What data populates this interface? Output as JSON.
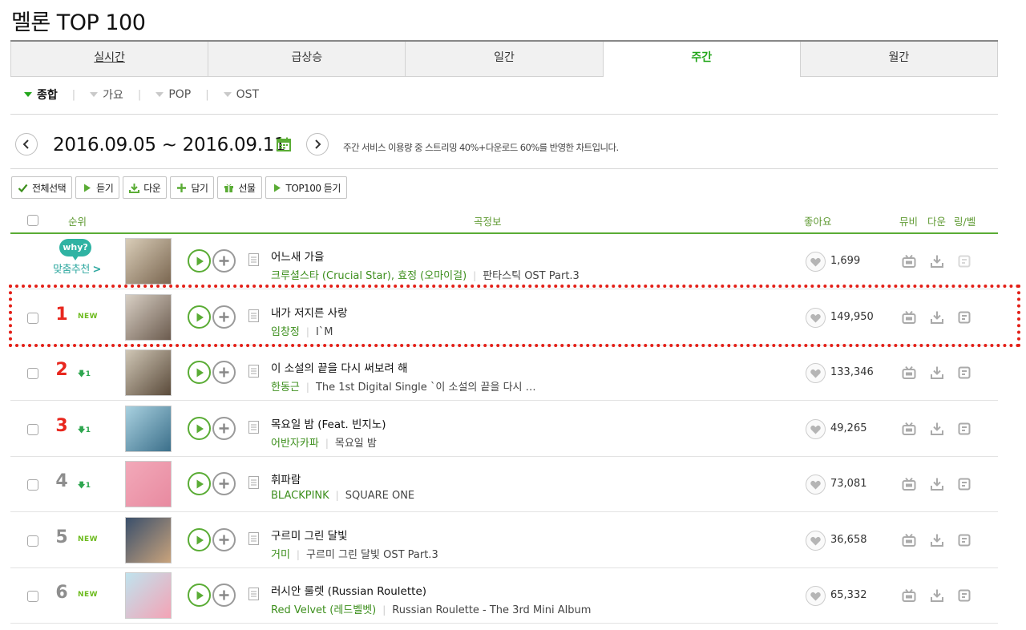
{
  "page": {
    "title": "멜론 TOP 100"
  },
  "tabs": [
    {
      "label": "실시간",
      "active": false
    },
    {
      "label": "급상승",
      "active": false
    },
    {
      "label": "일간",
      "active": false
    },
    {
      "label": "주간",
      "active": true
    },
    {
      "label": "월간",
      "active": false
    }
  ],
  "genres": [
    {
      "label": "종합",
      "active": true
    },
    {
      "label": "가요",
      "active": false
    },
    {
      "label": "POP",
      "active": false
    },
    {
      "label": "OST",
      "active": false
    }
  ],
  "date": {
    "range": "2016.09.05 ~ 2016.09.11",
    "description": "주간 서비스 이용량 중 스트리밍 40%+다운로드 60%를 반영한 차트입니다."
  },
  "actions": {
    "select_all": "전체선택",
    "listen": "듣기",
    "download": "다운",
    "add": "담기",
    "gift": "선물",
    "top100_listen": "TOP100 듣기"
  },
  "table_header": {
    "rank": "순위",
    "song_info": "곡정보",
    "likes": "좋아요",
    "mv": "뮤비",
    "download": "다운",
    "ring": "링/벨"
  },
  "recommend": {
    "badge": "why?",
    "text": "맞춤추천",
    "arrow": ">",
    "title": "어느새 가을",
    "artist": "크루셜스타 (Crucial Star), 효정 (오마이걸)",
    "album": "판타스틱 OST Part.3",
    "likes": "1,699"
  },
  "rows": [
    {
      "rank": "1",
      "change": "NEW",
      "change_type": "new",
      "title": "내가 저지른 사랑",
      "artist": "임창정",
      "album": "I`M",
      "likes": "149,950",
      "cover_colors": [
        "#d8cfc4",
        "#6b5b4e"
      ]
    },
    {
      "rank": "2",
      "change": "1",
      "change_type": "down",
      "title": "이 소설의 끝을 다시 써보려 해",
      "artist": "한동근",
      "album": "The 1st Digital Single `이 소설의 끝을 다시 …",
      "likes": "133,346",
      "cover_colors": [
        "#cfc6b5",
        "#5a4a3a"
      ]
    },
    {
      "rank": "3",
      "change": "1",
      "change_type": "down",
      "title": "목요일 밤 (Feat. 빈지노)",
      "artist": "어반자카파",
      "album": "목요일 밤",
      "likes": "49,265",
      "cover_colors": [
        "#a9d1e0",
        "#3b6f8a"
      ]
    },
    {
      "rank": "4",
      "change": "1",
      "change_type": "down",
      "title": "휘파람",
      "artist": "BLACKPINK",
      "album": "SQUARE ONE",
      "likes": "73,081",
      "cover_colors": [
        "#f2a9b9",
        "#e88aa0"
      ]
    },
    {
      "rank": "5",
      "change": "NEW",
      "change_type": "new",
      "title": "구르미 그린 달빛",
      "artist": "거미",
      "album": "구르미 그린 달빛 OST Part.3",
      "likes": "36,658",
      "cover_colors": [
        "#3a4f6b",
        "#c9a37c"
      ]
    },
    {
      "rank": "6",
      "change": "NEW",
      "change_type": "new",
      "title": "러시안 룰렛 (Russian Roulette)",
      "artist": "Red Velvet (레드벨벳)",
      "album": "Russian Roulette - The 3rd Mini Album",
      "likes": "65,332",
      "cover_colors": [
        "#bfe3ee",
        "#f4a3b5"
      ]
    }
  ],
  "colors": {
    "accent_green": "#5aac35",
    "rank_red": "#e8271e",
    "highlight_red": "#e32018",
    "teal": "#2fb3a3"
  }
}
